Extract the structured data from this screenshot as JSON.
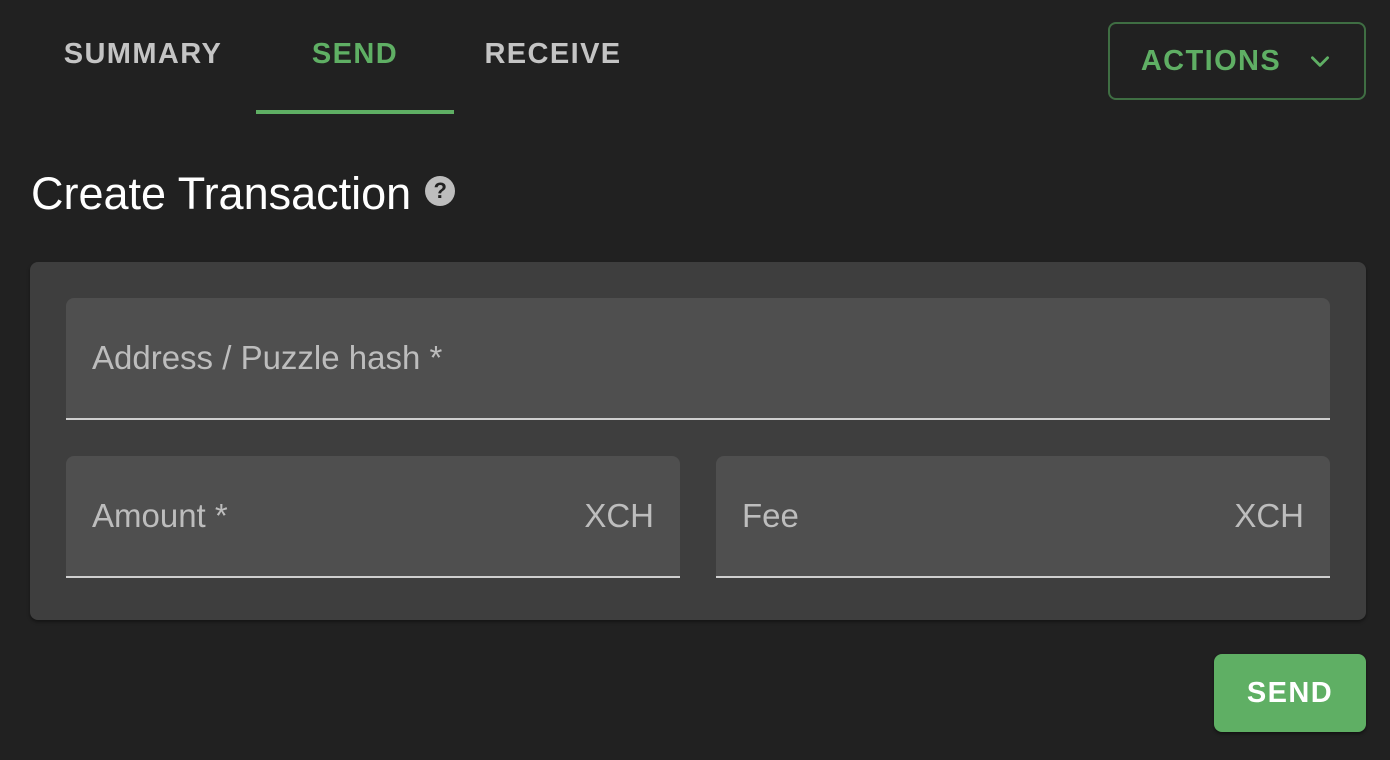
{
  "tabs": [
    {
      "label": "SUMMARY",
      "active": false
    },
    {
      "label": "SEND",
      "active": true
    },
    {
      "label": "RECEIVE",
      "active": false
    }
  ],
  "actions": {
    "label": "ACTIONS",
    "icon": "chevron-down-icon"
  },
  "page": {
    "title": "Create Transaction",
    "help_icon": "help-circle-icon",
    "help_glyph": "?"
  },
  "form": {
    "address": {
      "label": "Address / Puzzle hash *",
      "value": ""
    },
    "amount": {
      "label": "Amount *",
      "unit": "XCH",
      "value": ""
    },
    "fee": {
      "label": "Fee",
      "unit": "XCH",
      "value": ""
    }
  },
  "submit": {
    "label": "SEND"
  },
  "colors": {
    "background": "#212121",
    "accent": "#5faf64",
    "card": "#3e3e3e",
    "field": "#4f4f4f"
  }
}
